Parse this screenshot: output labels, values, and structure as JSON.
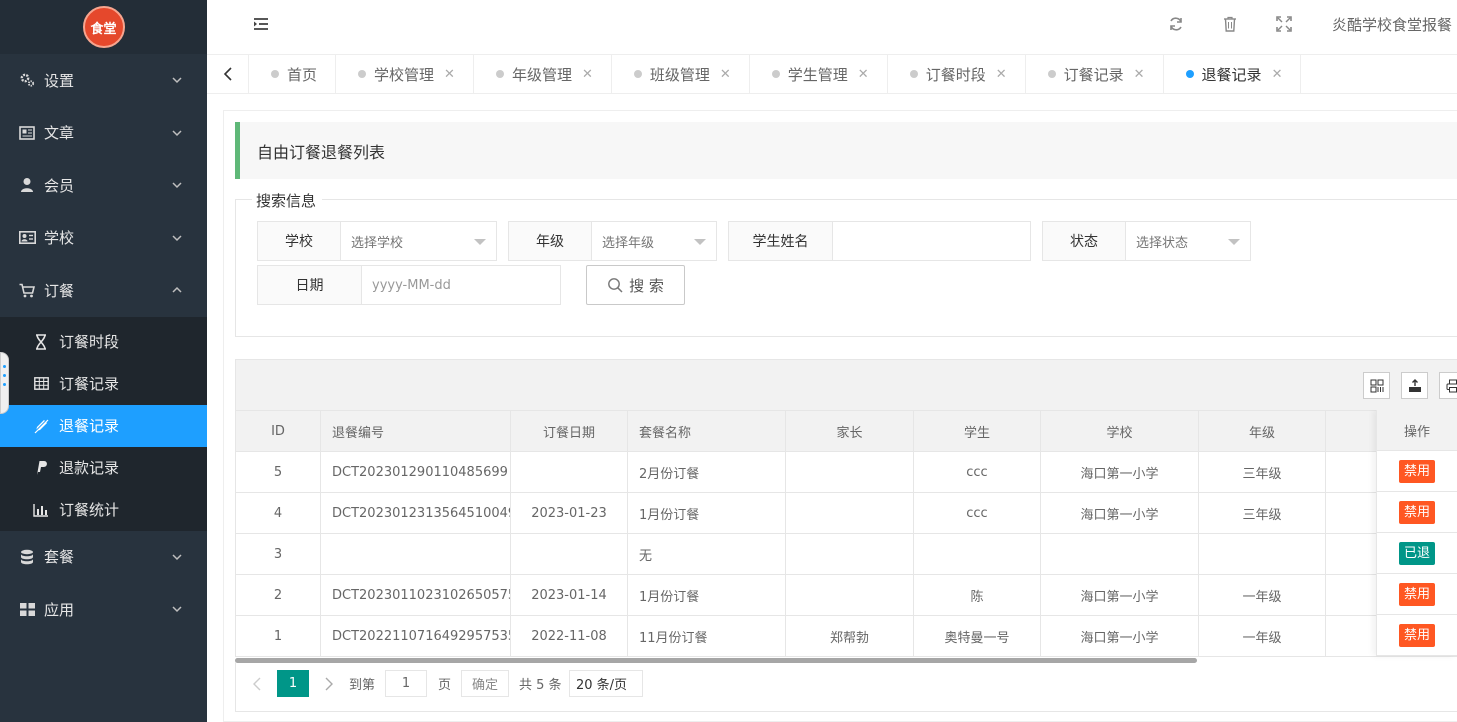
{
  "logo_text": "食堂",
  "sidebar": {
    "items": [
      {
        "label": "设置",
        "icon": "gear-icon"
      },
      {
        "label": "文章",
        "icon": "newspaper-icon"
      },
      {
        "label": "会员",
        "icon": "user-icon"
      },
      {
        "label": "学校",
        "icon": "id-card-icon"
      },
      {
        "label": "订餐",
        "icon": "cart-icon",
        "expanded": true
      }
    ],
    "submenu": [
      {
        "label": "订餐时段",
        "icon": "hourglass-icon"
      },
      {
        "label": "订餐记录",
        "icon": "table-icon"
      },
      {
        "label": "退餐记录",
        "icon": "pencil-slash-icon",
        "active": true
      },
      {
        "label": "退款记录",
        "icon": "paypal-icon"
      },
      {
        "label": "订餐统计",
        "icon": "bar-chart-icon"
      }
    ],
    "items_after": [
      {
        "label": "套餐",
        "icon": "database-icon"
      },
      {
        "label": "应用",
        "icon": "grid-icon"
      }
    ]
  },
  "header": {
    "site_name": "炎酷学校食堂报餐"
  },
  "tabs": [
    {
      "label": "首页",
      "closable": false
    },
    {
      "label": "学校管理",
      "closable": true
    },
    {
      "label": "年级管理",
      "closable": true
    },
    {
      "label": "班级管理",
      "closable": true
    },
    {
      "label": "学生管理",
      "closable": true
    },
    {
      "label": "订餐时段",
      "closable": true
    },
    {
      "label": "订餐记录",
      "closable": true
    },
    {
      "label": "退餐记录",
      "closable": true,
      "active": true
    }
  ],
  "page_title": "自由订餐退餐列表",
  "search": {
    "legend": "搜索信息",
    "school_label": "学校",
    "school_value": "选择学校",
    "grade_label": "年级",
    "grade_value": "选择年级",
    "name_label": "学生姓名",
    "name_value": "",
    "status_label": "状态",
    "status_value": "选择状态",
    "date_label": "日期",
    "date_placeholder": "yyyy-MM-dd",
    "button_label": "搜 索"
  },
  "table": {
    "columns": [
      "ID",
      "退餐编号",
      "订餐日期",
      "套餐名称",
      "家长",
      "学生",
      "学校",
      "年级",
      ""
    ],
    "op_header": "操作",
    "rows": [
      {
        "id": "5",
        "code": "DCT202301290110485699",
        "date": "",
        "meal": "2月份订餐",
        "parent": "",
        "student": "ccc",
        "school": "海口第一小学",
        "grade": "三年级",
        "status": "禁用",
        "status_kind": "danger"
      },
      {
        "id": "4",
        "code": "DCT2023012313564510049",
        "date": "2023-01-23",
        "meal": "1月份订餐",
        "parent": "",
        "student": "ccc",
        "school": "海口第一小学",
        "grade": "三年级",
        "status": "禁用",
        "status_kind": "danger"
      },
      {
        "id": "3",
        "code": "",
        "date": "",
        "meal": "无",
        "parent": "",
        "student": "",
        "school": "",
        "grade": "",
        "status": "已退",
        "status_kind": "ok"
      },
      {
        "id": "2",
        "code": "DCT2023011023102650575",
        "date": "2023-01-14",
        "meal": "1月份订餐",
        "parent": "",
        "student": "陈",
        "school": "海口第一小学",
        "grade": "一年级",
        "status": "禁用",
        "status_kind": "danger"
      },
      {
        "id": "1",
        "code": "DCT2022110716492957535",
        "date": "2022-11-08",
        "meal": "11月份订餐",
        "parent": "郑帮勃",
        "student": "奥特曼一号",
        "school": "海口第一小学",
        "grade": "一年级",
        "status": "禁用",
        "status_kind": "danger"
      }
    ]
  },
  "pager": {
    "current": "1",
    "goto_label": "到第",
    "goto_value": "1",
    "page_unit": "页",
    "confirm": "确定",
    "total": "共 5 条",
    "page_size": "20 条/页"
  },
  "colors": {
    "sidebar_bg": "#28333e",
    "active_blue": "#1e9fff",
    "danger": "#ff5722",
    "ok": "#009688",
    "title_accent": "#5fb878"
  }
}
